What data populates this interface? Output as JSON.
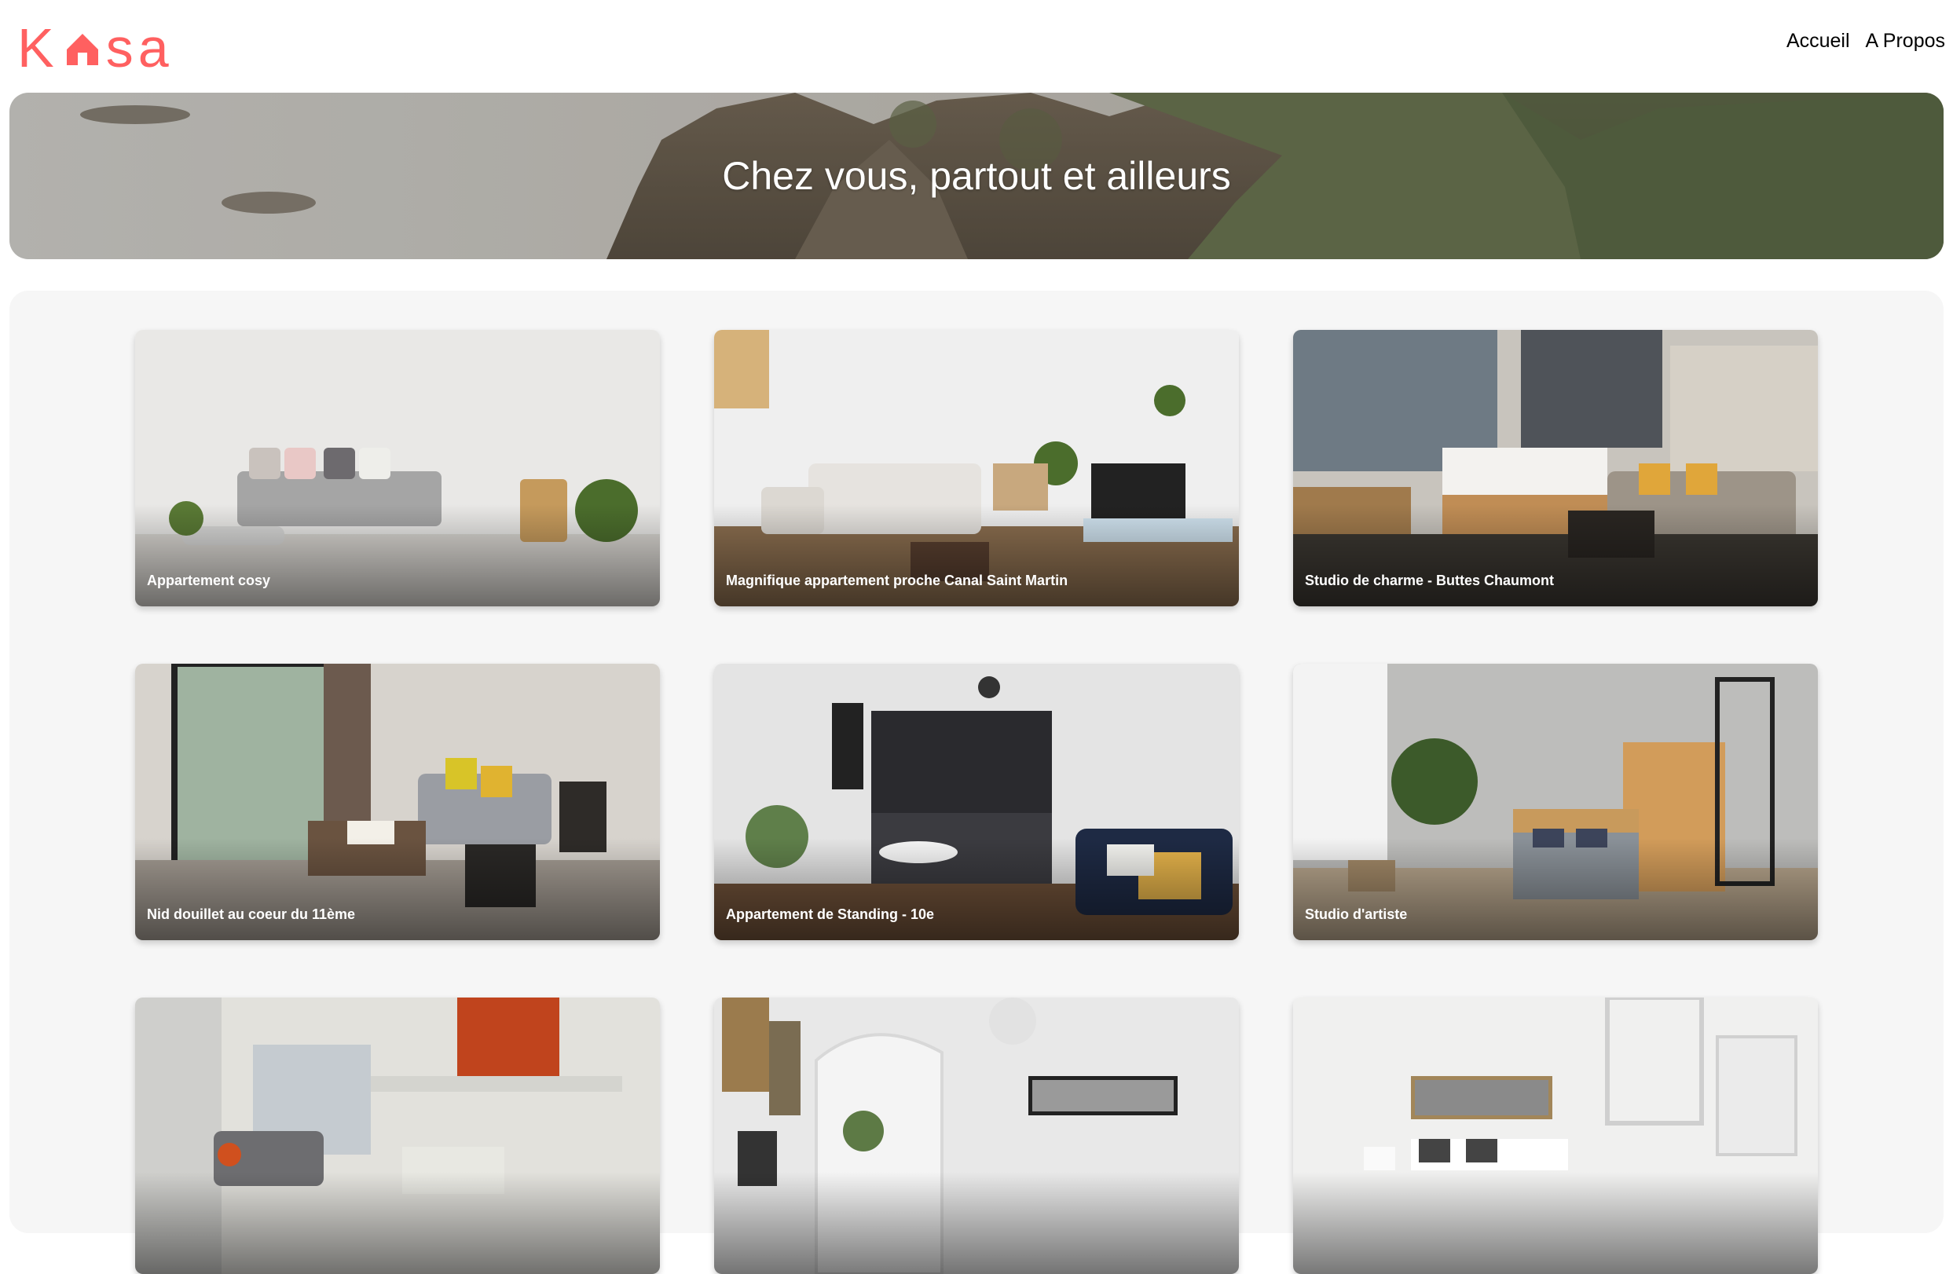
{
  "header": {
    "logo_text_k": "K",
    "logo_text_sa": "sa",
    "nav": [
      {
        "label": "Accueil"
      },
      {
        "label": "A Propos"
      }
    ]
  },
  "banner": {
    "title": "Chez vous, partout et ailleurs"
  },
  "colors": {
    "brand": "#ff6060",
    "gallery_bg": "#f6f6f6"
  },
  "listings": [
    {
      "title": "Appartement cosy"
    },
    {
      "title": "Magnifique appartement proche Canal Saint Martin"
    },
    {
      "title": "Studio de charme - Buttes Chaumont"
    },
    {
      "title": "Nid douillet au coeur du 11ème"
    },
    {
      "title": "Appartement de Standing - 10e"
    },
    {
      "title": "Studio d'artiste"
    },
    {
      "title": ""
    },
    {
      "title": ""
    },
    {
      "title": ""
    }
  ]
}
